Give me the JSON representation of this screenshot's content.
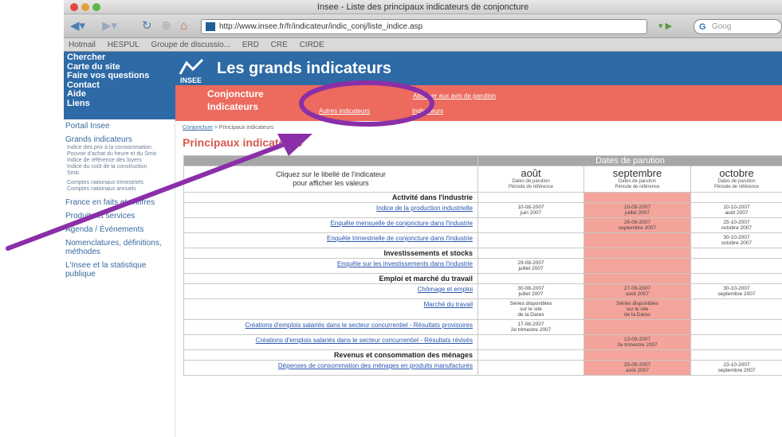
{
  "window": {
    "title": "Insee - Liste des principaux indicateurs de conjoncture"
  },
  "toolbar": {
    "url": "http://www.insee.fr/fr/indicateur/indic_conj/liste_indice.asp",
    "search_placeholder": "Goog"
  },
  "bookmarks": [
    "Hotmail",
    "HESPUL",
    "Groupe de discussio...",
    "ERD",
    "CRE",
    "CIRDE"
  ],
  "leftbox": [
    "Chercher",
    "Carte du site",
    "Faire vos questions",
    "Contact",
    "Aide",
    "Liens"
  ],
  "leftnav": {
    "portail": "Portail Insee",
    "grands": "Grands indicateurs",
    "grands_sub": [
      "Indice des prix à la consommation",
      "Pouvoir d'achat du heure et du Smic",
      "Indice de référence des loyers",
      "Indice du coût de la construction",
      "Smic"
    ],
    "comptes": [
      "Comptes nationaux trimestriels",
      "Comptes nationaux annuels"
    ],
    "items": [
      "France en faits et chiffres",
      "Produits et services",
      "Agenda / Événements",
      "Nomenclatures, définitions, méthodes",
      "L'Insee et la statistique publique"
    ]
  },
  "header": {
    "logo": "INSEE",
    "title": "Les grands indicateurs"
  },
  "redbar": {
    "main1": "Conjoncture",
    "main2": "Indicateurs",
    "link1": "Abonner aux avis de parution",
    "link2": "Autres indicateurs",
    "link3": "Indicateurs"
  },
  "breadcrumb": {
    "link": "Conjoncture",
    "rest": " > Principaux indicateurs"
  },
  "page_title": "Principaux indicateurs",
  "table": {
    "dates_header": "Dates de parution",
    "instruction1": "Cliquez sur le libellé de l'indicateur",
    "instruction2": "pour afficher les valeurs",
    "months": [
      {
        "name": "août",
        "sub1": "Dates de parution",
        "sub2": "Période de référence"
      },
      {
        "name": "septembre",
        "sub1": "Dates de parution",
        "sub2": "Période de référence"
      },
      {
        "name": "octobre",
        "sub1": "Dates de parution",
        "sub2": "Période de référence"
      }
    ],
    "rows": [
      {
        "type": "section",
        "label": "Activité dans l'industrie"
      },
      {
        "type": "ind",
        "label": "Indice de la production industrielle",
        "c": [
          [
            "10-08-2007",
            "juin 2007"
          ],
          [
            "10-09-2007",
            "juillet 2007"
          ],
          [
            "10-10-2007",
            "août 2007"
          ]
        ]
      },
      {
        "type": "ind",
        "label": "Enquête mensuelle de conjoncture dans l'industrie",
        "c": [
          [],
          [
            "26-09-2007",
            "septembre 2007"
          ],
          [
            "25-10-2007",
            "octobre 2007"
          ]
        ]
      },
      {
        "type": "ind",
        "label": "Enquête trimestrielle de conjoncture dans l'industrie",
        "c": [
          [],
          [],
          [
            "30-10-2007",
            "octobre 2007"
          ]
        ]
      },
      {
        "type": "section",
        "label": "Investissements et stocks"
      },
      {
        "type": "ind",
        "label": "Enquête sur les investissements dans l'industrie",
        "c": [
          [
            "29-08-2007",
            "juillet 2007"
          ],
          [],
          []
        ]
      },
      {
        "type": "section",
        "label": "Emploi et marché du travail"
      },
      {
        "type": "ind",
        "label": "Chômage et emploi",
        "c": [
          [
            "30-08-2007",
            "juillet 2007"
          ],
          [
            "27-09-2007",
            "août 2007"
          ],
          [
            "30-10-2007",
            "septembre 2007"
          ]
        ]
      },
      {
        "type": "ind",
        "label": "Marché du travail",
        "c": [
          [
            "Séries disponibles",
            "sur le site",
            "de la Dares"
          ],
          [
            "Séries disponibles",
            "sur le site",
            "de la Dares"
          ],
          []
        ]
      },
      {
        "type": "ind",
        "label": "Créations d'emplois salariés dans le secteur concurrentiel - Résultats provisoires",
        "c": [
          [
            "17-08-2007",
            "2e trimestre 2007"
          ],
          [],
          []
        ]
      },
      {
        "type": "ind",
        "label": "Créations d'emplois salariés dans le secteur concurrentiel - Résultats révisés",
        "c": [
          [],
          [
            "13-09-2007",
            "2e trimestre 2007"
          ],
          []
        ]
      },
      {
        "type": "section",
        "label": "Revenus et consommation des ménages"
      },
      {
        "type": "ind",
        "label": "Dépenses de consommation des ménages en produits manufacturés",
        "c": [
          [],
          [
            "25-09-2007",
            "août 2007"
          ],
          [
            "23-10-2007",
            "septembre 2007"
          ]
        ]
      }
    ]
  },
  "colors": {
    "header_blue": "#2d6aa6",
    "red_bar": "#ec6a5e",
    "highlight": "#f4a49b",
    "annotation": "#8a2fa8"
  }
}
